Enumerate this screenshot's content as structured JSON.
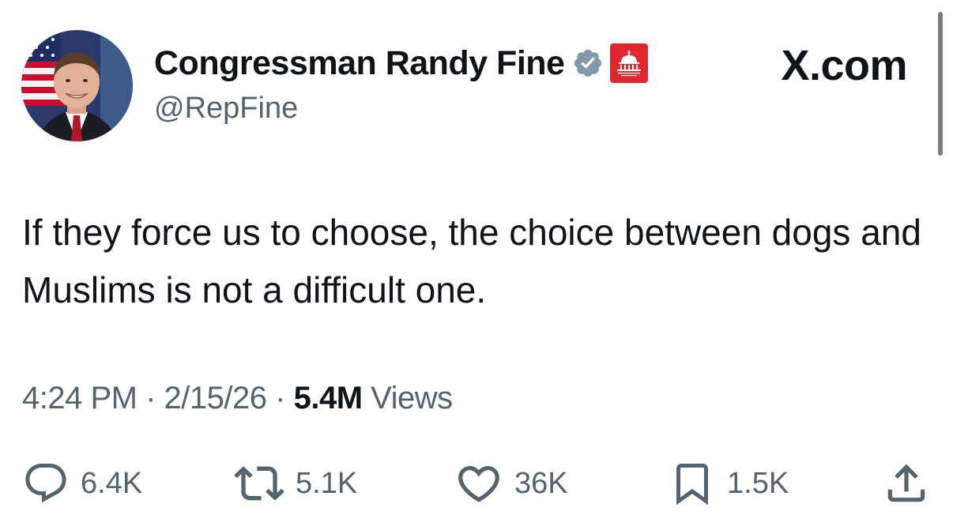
{
  "profile": {
    "display_name": "Congressman Randy Fine",
    "handle": "@RepFine",
    "verified": true,
    "affiliation_badge": "House GOP",
    "site_label": "X.com"
  },
  "tweet": {
    "text": "If they force us to choose, the choice between dogs and Muslims is not a difficult one.",
    "time": "4:24 PM",
    "date": "2/15/26",
    "separator": "·",
    "views_count": "5.4M",
    "views_label": "Views"
  },
  "actions": {
    "replies": "6.4K",
    "reposts": "5.1K",
    "likes": "36K",
    "bookmarks": "1.5K"
  },
  "colors": {
    "text": "#0f1419",
    "secondary": "#536471",
    "verified_badge": "#829aab",
    "gop_badge": "#e0262e"
  },
  "icons": {
    "reply": "reply-icon",
    "repost": "repost-icon",
    "like": "heart-icon",
    "bookmark": "bookmark-icon",
    "share": "share-icon",
    "verified": "verified-badge-icon",
    "affiliation": "house-gop-badge-icon"
  }
}
